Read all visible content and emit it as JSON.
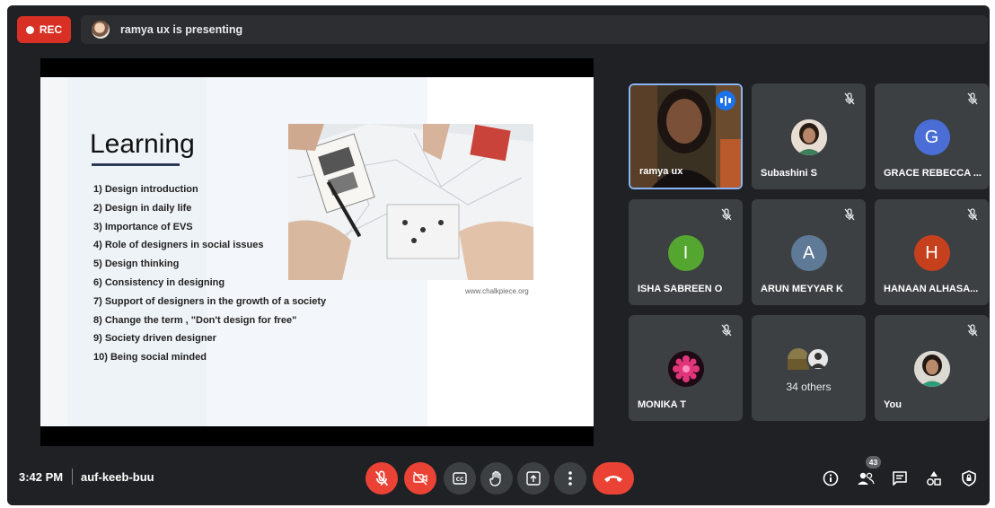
{
  "recording": {
    "label": "REC"
  },
  "presenting": {
    "text": "ramya ux is presenting"
  },
  "slide": {
    "title": "Learning",
    "items": [
      "1) Design introduction",
      "2) Design in daily life",
      "3) Importance of EVS",
      "4) Role of designers in social issues",
      "5) Design thinking",
      "6) Consistency in designing",
      "7) Support of designers in the growth of a society",
      "8) Change the term , \"Don't design for free\"",
      "9) Society driven designer",
      "10) Being social minded"
    ],
    "photo_credit": "www.chalkpiece.org"
  },
  "participants": [
    {
      "name": "ramya ux",
      "type": "video",
      "speaking": true
    },
    {
      "name": "Subashini S",
      "type": "photo",
      "muted": true
    },
    {
      "name": "GRACE REBECCA ...",
      "initial": "G",
      "color": "#4a6ed6",
      "muted": true
    },
    {
      "name": "ISHA SABREEN O",
      "initial": "I",
      "color": "#55a630",
      "muted": true
    },
    {
      "name": "ARUN MEYYAR K",
      "initial": "A",
      "color": "#5f7a96",
      "muted": true
    },
    {
      "name": "HANAAN ALHASA...",
      "initial": "H",
      "color": "#c7401d",
      "muted": true
    },
    {
      "name": "MONIKA T",
      "type": "photo",
      "muted": true
    },
    {
      "name": "You",
      "type": "photo",
      "muted": true
    }
  ],
  "others": {
    "label": "34 others"
  },
  "footer": {
    "time": "3:42 PM",
    "meeting_code": "auf-keeb-buu",
    "participant_count": "43"
  },
  "colors": {
    "background": "#202124",
    "tile": "#3c4043",
    "danger": "#ea4335",
    "accent": "#1a73e8"
  }
}
